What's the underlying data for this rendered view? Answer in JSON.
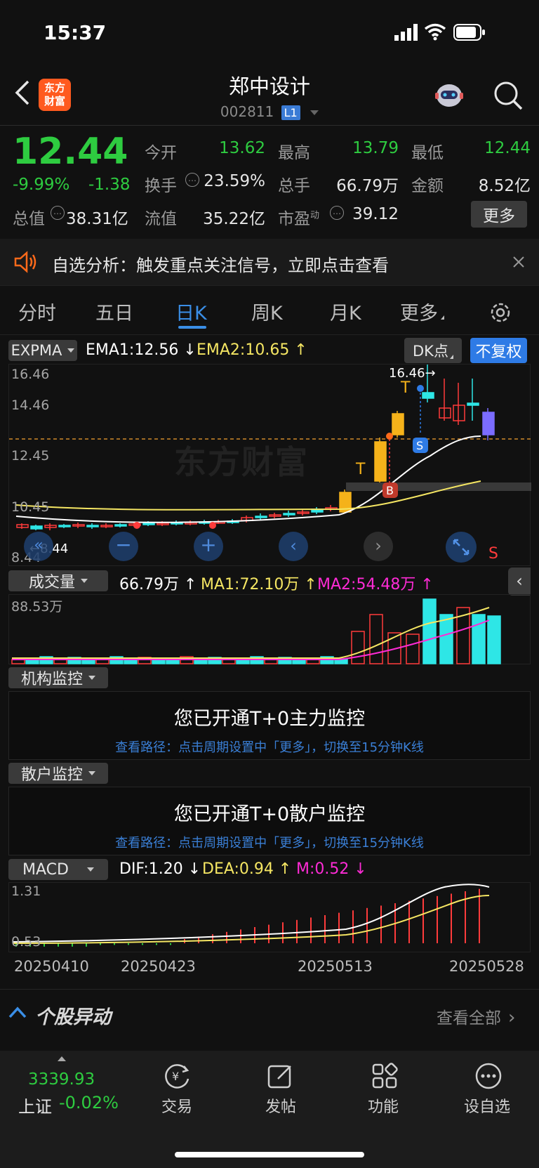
{
  "status_bar": {
    "time": "15:37"
  },
  "header": {
    "app_logo": "东方\n财富",
    "stock_name": "郑中设计",
    "stock_code": "002811",
    "level_badge": "L1"
  },
  "quote": {
    "price": "12.44",
    "change_pct": "-9.99%",
    "change": "-1.38",
    "open_label": "今开",
    "open": "13.62",
    "high_label": "最高",
    "high": "13.79",
    "low_label": "最低",
    "low": "12.44",
    "turnover_label": "换手",
    "turnover": "23.59%",
    "volume_label": "总手",
    "volume": "66.79万",
    "amount_label": "金额",
    "amount": "8.52亿",
    "mktcap_label": "总值",
    "mktcap": "38.31亿",
    "float_label": "流值",
    "float": "35.22亿",
    "pe_label": "市盈",
    "pe_sup": "动",
    "pe": "39.12",
    "more_button": "更多"
  },
  "banner": {
    "text": "自选分析：触发重点关注信号，立即点击查看"
  },
  "tabs": [
    "分时",
    "五日",
    "日K",
    "周K",
    "月K",
    "更多"
  ],
  "active_tab": "日K",
  "kline": {
    "indicator": "EXPMA",
    "ema1": "EMA1:12.56",
    "ema2": "EMA2:10.65",
    "dk_button": "DK点",
    "adjust_button": "不复权",
    "max_label": "16.46→",
    "y_ticks": [
      "16.46",
      "14.46",
      "12.45",
      "10.45",
      "8.44"
    ],
    "low_marker": "8.44",
    "t_marks": [
      "T",
      "T"
    ],
    "s_mark": "S",
    "b_mark": "B",
    "s_red": "S",
    "watermark": "东方财富"
  },
  "volume": {
    "indicator": "成交量",
    "vol": "66.79万",
    "ma1": "MA1:72.10万",
    "ma2": "MA2:54.48万",
    "max_label": "88.53万"
  },
  "inst_monitor": {
    "label": "机构监控",
    "title": "您已开通T+0主力监控",
    "path": "查看路径：点击周期设置中「更多」，切换至15分钟K线"
  },
  "retail_monitor": {
    "label": "散户监控",
    "title": "您已开通T+0散户监控",
    "path": "查看路径：点击周期设置中「更多」，切换至15分钟K线"
  },
  "macd": {
    "indicator": "MACD",
    "dif": "DIF:1.20",
    "dea": "DEA:0.94",
    "m": "M:0.52",
    "y_top": "1.31",
    "y_bottom": "0.53",
    "dates": [
      "20250410",
      "20250423",
      "20250513",
      "20250528"
    ]
  },
  "news_section": {
    "title": "个股异动",
    "view_all": "查看全部"
  },
  "bottom_nav": {
    "index_value": "3339.93",
    "index_name": "上证",
    "index_change": "-0.02%",
    "items": [
      "交易",
      "发帖",
      "功能",
      "设自选"
    ]
  },
  "colors": {
    "up": "#ff3b3b",
    "down": "#2ecc40",
    "cyan": "#2ee6e6",
    "yellow": "#f5e663",
    "magenta": "#ff2bd6",
    "orange": "#ff6a1a",
    "blue": "#2e7be6"
  }
}
